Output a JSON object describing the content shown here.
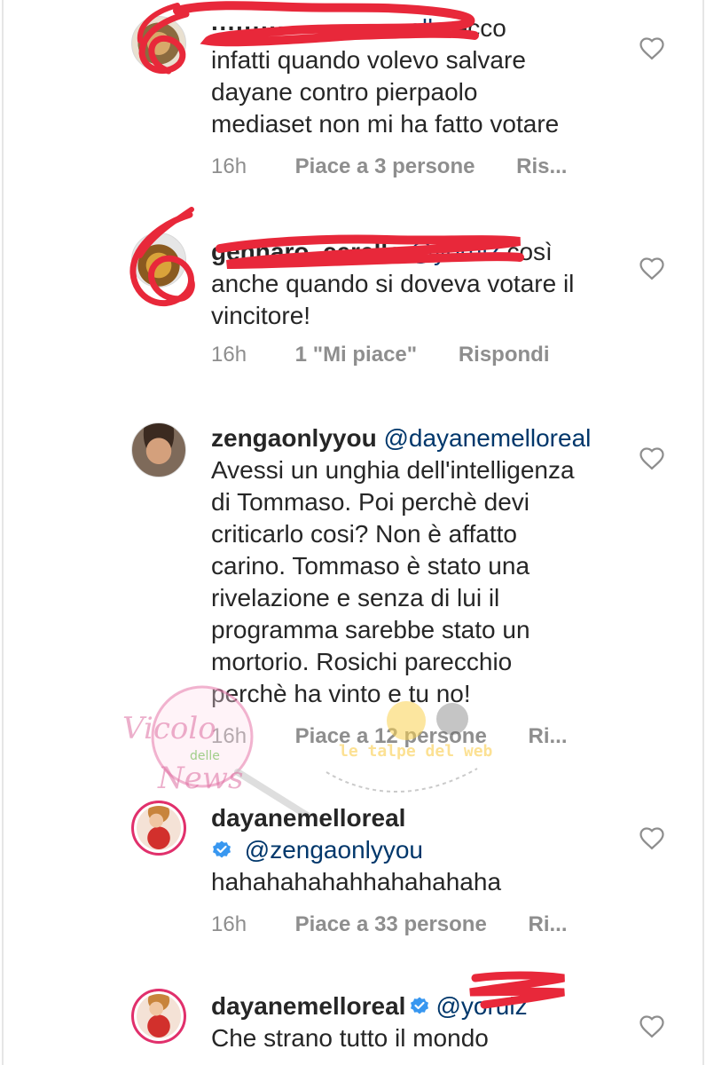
{
  "comments": [
    {
      "username_visible": "",
      "mention": "ella",
      "text": "ecco infatti quando volevo salvare dayane contro pierpaolo mediaset non mi ha fatto votare",
      "line2": "infatti quando volevo salvare",
      "line3": "dayane contro pierpaolo",
      "line4": "mediaset non mi ha fatto votare",
      "line1_tail": "ecco",
      "time": "16h",
      "likes": "Piace a 3 persone",
      "reply": "Ris...",
      "redacted": true
    },
    {
      "username_visible": "gennaro_cerella",
      "mention": "@yoruiz",
      "line1_tail": "così",
      "line2": "anche quando si doveva votare il",
      "line3": "vincitore!",
      "time": "16h",
      "likes": "1 \"Mi piace\"",
      "reply": "Rispondi",
      "redacted": true
    },
    {
      "username": "zengaonlyyou",
      "mention": "@dayanemelloreal",
      "lines": [
        "Avessi un unghia dell'intelligenza",
        "di Tommaso. Poi perchè devi",
        "criticarlo cosi? Non è affatto",
        "carino. Tommaso è stato una",
        "rivelazione e senza di lui il",
        "programma sarebbe stato un",
        "mortorio. Rosichi parecchio",
        "perchè ha vinto e tu no!"
      ],
      "time": "16h",
      "likes": "Piace a 12 persone",
      "reply": "Ri..."
    },
    {
      "username": "dayanemelloreal",
      "verified": true,
      "mention": "@zengaonlyyou",
      "text": "hahahahahahhahahahaha",
      "time": "16h",
      "likes": "Piace a 33 persone",
      "reply": "Ri..."
    },
    {
      "username": "dayanemelloreal",
      "verified": true,
      "mention": "@yoruiz",
      "text": "Che strano tutto il mondo"
    }
  ],
  "watermark": {
    "brand_top": "Vicolo",
    "brand_mid": "delle",
    "brand_bottom": "News",
    "tagline": "le talpe del web"
  },
  "icons": {
    "like": "heart-outline-icon",
    "verified": "verified-badge-icon"
  },
  "colors": {
    "text": "#262626",
    "meta": "#8e8e8e",
    "mention": "#00376b",
    "verified": "#3897f0",
    "redaction": "#e8283a"
  }
}
